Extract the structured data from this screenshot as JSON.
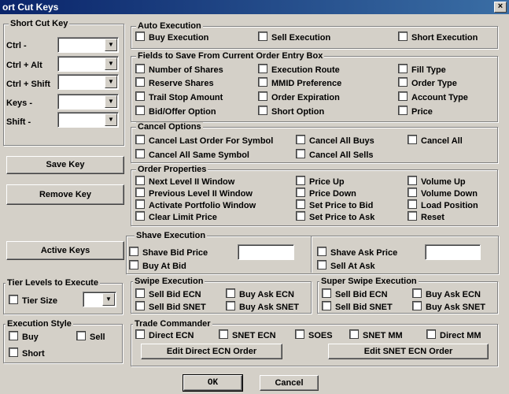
{
  "window": {
    "title": "ort Cut Keys",
    "close_label": "×"
  },
  "shortcut": {
    "title": "Short Cut Key",
    "rows": [
      {
        "label": "Ctrl -"
      },
      {
        "label": "Ctrl + Alt"
      },
      {
        "label": "Ctrl + Shift"
      },
      {
        "label": "Keys -"
      },
      {
        "label": "Shift -"
      }
    ],
    "arrow": "▼"
  },
  "buttons": {
    "save_key": "Save Key",
    "remove_key": "Remove Key",
    "active_keys": "Active Keys",
    "ok": "OK",
    "cancel": "Cancel",
    "edit_direct_ecn": "Edit Direct ECN Order",
    "edit_snet_ecn": "Edit SNET ECN Order"
  },
  "auto_execution": {
    "title": "Auto Execution",
    "items": [
      "Buy Execution",
      "Sell Execution",
      "Short Execution"
    ]
  },
  "fields": {
    "title": "Fields to Save From Current Order Entry Box",
    "items": [
      "Number of Shares",
      "Execution Route",
      "Fill Type",
      "Reserve Shares",
      "MMID Preference",
      "Order Type",
      "Trail Stop Amount",
      "Order Expiration",
      "Account Type",
      "Bid/Offer Option",
      "Short Option",
      "Price"
    ]
  },
  "cancel_options": {
    "title": "Cancel Options",
    "items": [
      "Cancel Last Order For Symbol",
      "Cancel All Buys",
      "Cancel All",
      "Cancel All Same Symbol",
      "Cancel All Sells"
    ]
  },
  "order_properties": {
    "title": "Order Properties",
    "items": [
      "Next Level II Window",
      "Price Up",
      "Volume Up",
      "Previous Level II Window",
      "Price Down",
      "Volume Down",
      "Activate Portfolio Window",
      "Set Price to Bid",
      "Load Position",
      "Clear Limit Price",
      "Set Price to Ask",
      "Reset"
    ]
  },
  "shave": {
    "title": "Shave Execution",
    "items": [
      "Shave Bid Price",
      "Buy At Bid",
      "Shave Ask Price",
      "Sell At Ask"
    ]
  },
  "tier": {
    "title": "Tier Levels to Execute",
    "item": "Tier Size"
  },
  "swipe": {
    "title": "Swipe Execution",
    "items": [
      "Sell Bid ECN",
      "Buy Ask ECN",
      "Sell Bid SNET",
      "Buy Ask SNET"
    ]
  },
  "super_swipe": {
    "title": "Super Swipe Execution",
    "items": [
      "Sell Bid ECN",
      "Buy Ask ECN",
      "Sell Bid SNET",
      "Buy Ask SNET"
    ]
  },
  "exec_style": {
    "title": "Execution Style",
    "items": [
      "Buy",
      "Sell",
      "Short"
    ]
  },
  "trade_commander": {
    "title": "Trade Commander",
    "items": [
      "Direct ECN",
      "SNET ECN",
      "SOES",
      "SNET MM",
      "Direct MM"
    ]
  }
}
